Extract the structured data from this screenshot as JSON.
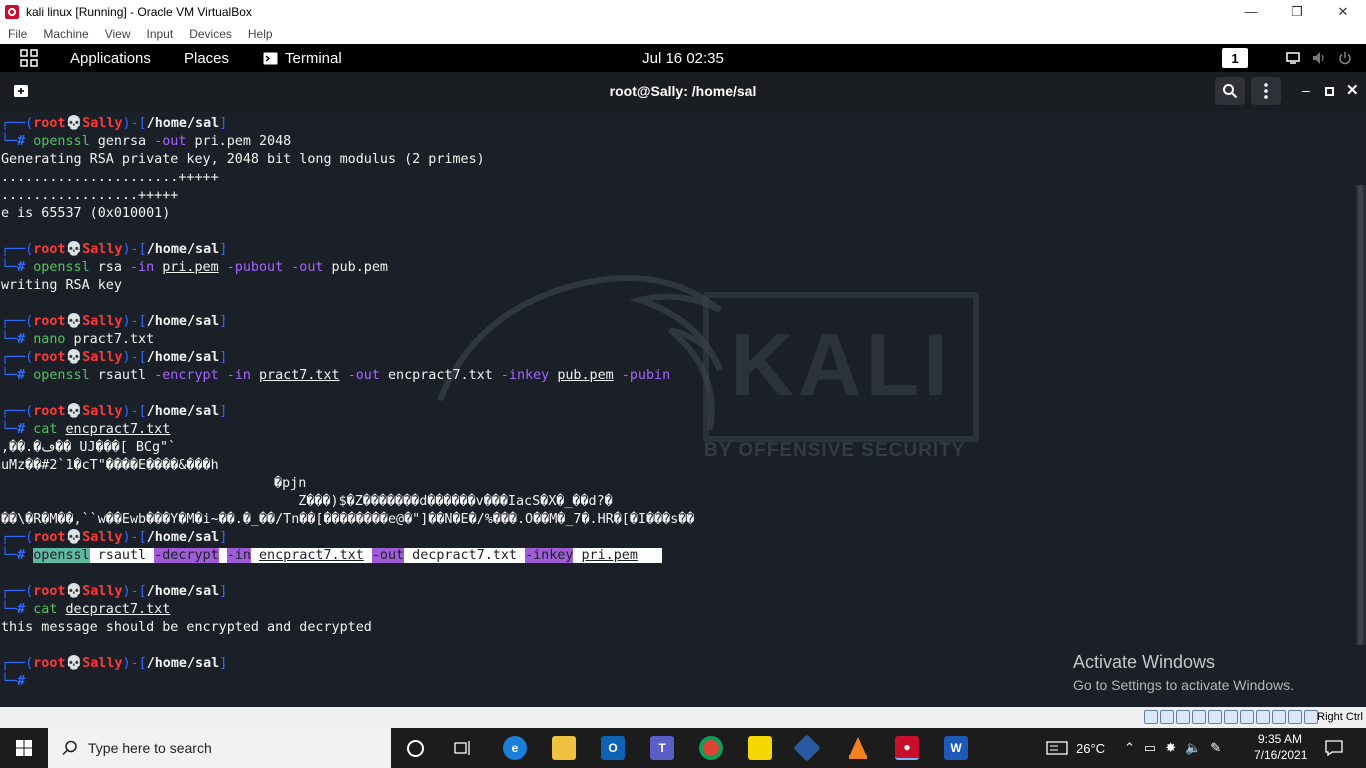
{
  "vbox": {
    "title": "kali linux [Running] - Oracle VM VirtualBox",
    "menu": [
      "File",
      "Machine",
      "View",
      "Input",
      "Devices",
      "Help"
    ],
    "host_key": "Right Ctrl"
  },
  "panel": {
    "applications": "Applications",
    "places": "Places",
    "terminal": "Terminal",
    "clock": "Jul 16  02:35",
    "workspace": "1"
  },
  "terminal": {
    "title": "root@Sally: /home/sal",
    "prompt_user": "root",
    "prompt_host": "Sally",
    "prompt_dir": "/home/sal",
    "cmd1": "openssl",
    "cmd1_rest1": " genrsa ",
    "cmd1_opt": "-out",
    "cmd1_rest2": " pri.pem 2048",
    "out1": "Generating RSA private key, 2048 bit long modulus (2 primes)",
    "out2": "......................+++++",
    "out3": ".................+++++",
    "out4": "e is 65537 (0x010001)",
    "cmd2": "openssl",
    "cmd2_rsa": " rsa ",
    "cmd2_in": "-in",
    "cmd2_file": "pri.pem",
    "cmd2_pubout": "-pubout",
    "cmd2_out": "-out",
    "cmd2_outfile": " pub.pem",
    "out5": "writing RSA key",
    "cmd3": "nano",
    "cmd3_file": " pract7.txt",
    "cmd4": "openssl",
    "cmd4_rsautl": " rsautl ",
    "cmd4_encrypt": "-encrypt",
    "cmd4_in": "-in",
    "cmd4_infile": "pract7.txt",
    "cmd4_out": "-out",
    "cmd4_outfile": " encpract7.txt ",
    "cmd4_inkey": "-inkey",
    "cmd4_keyfile": "pub.pem",
    "cmd4_pubin": "-pubin",
    "cmd5": "cat",
    "cmd5_file": "encpract7.txt",
    "garbage1": ",��.�ڡ�� UJ���[ BCg\"`",
    "garbage2": "uMz��#2`1�cT\"����E����&���h",
    "garbage3": "                                 �pjn",
    "garbage4": "                                     Z���)$�Z�������d������v���IacS�X�_��d?�",
    "garbage5": "��\\�R�M��,``w��Ewb���Y�M�i~��.�_��/Tn��[��������e@�\"]��N�E�/%���.O��M�_7�.HR�[�I���s��",
    "cmd6": "openssl",
    "cmd6_rsautl": " rsautl ",
    "cmd6_decrypt": "-decrypt",
    "cmd6_in": "-in",
    "cmd6_infile": "encpract7.txt",
    "cmd6_out": "-out",
    "cmd6_outfile": " decpract7.txt ",
    "cmd6_inkey": "-inkey",
    "cmd6_keyfile": "pri.pem",
    "cmd7": "cat",
    "cmd7_file": "decpract7.txt",
    "out6": "this message should be encrypted and decrypted",
    "prompt_char": "#"
  },
  "watermark": {
    "title": "Activate Windows",
    "subtitle": "Go to Settings to activate Windows.",
    "kali_logo": "KALI",
    "kali_tagline": "BY OFFENSIVE SECURITY"
  },
  "taskbar": {
    "search_placeholder": "Type here to search",
    "weather": "26°C",
    "time": "9:35 AM",
    "date": "7/16/2021"
  }
}
